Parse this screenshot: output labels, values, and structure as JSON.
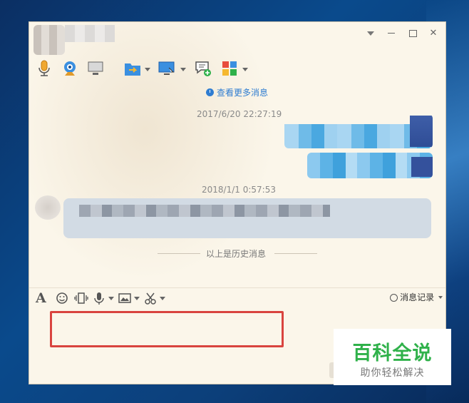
{
  "window": {
    "controls": {
      "dropdown": "▼",
      "minimize": "—",
      "maximize": "□",
      "close": "✕"
    }
  },
  "toolbar": {
    "icons": [
      "microphone-icon",
      "webcam-icon",
      "screen-share-icon",
      "file-transfer-icon",
      "remote-desktop-icon",
      "add-chat-icon",
      "apps-icon"
    ]
  },
  "chat": {
    "more_messages": "查看更多消息",
    "messages": [
      {
        "timestamp": "2017/6/20 22:27:19",
        "side": "right"
      },
      {
        "timestamp": "2018/1/1 0:57:53",
        "side": "left"
      }
    ],
    "history_divider": "以上是历史消息"
  },
  "input_toolbar": {
    "font_glyph": "A",
    "history_label": "消息记录"
  },
  "watermark": {
    "title": "百科全说",
    "subtitle": "助你轻松解决"
  },
  "colors": {
    "accent_blue": "#2f7dd1",
    "highlight_red": "#d9443f",
    "watermark_green": "#2fb14a"
  }
}
